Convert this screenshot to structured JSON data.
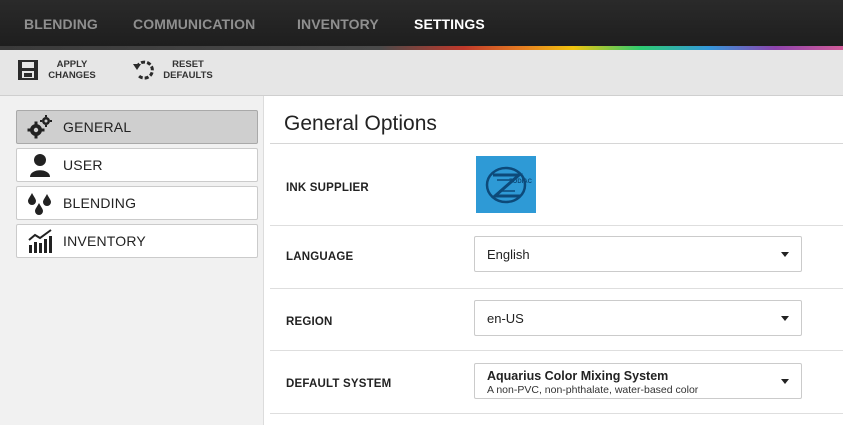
{
  "nav": {
    "tabs": [
      {
        "label": "BLENDING",
        "active": false
      },
      {
        "label": "COMMUNICATION",
        "active": false
      },
      {
        "label": "INVENTORY",
        "active": false
      },
      {
        "label": "SETTINGS",
        "active": true
      }
    ]
  },
  "toolbar": {
    "apply": {
      "line1": "APPLY",
      "line2": "CHANGES",
      "icon": "save-icon"
    },
    "reset": {
      "line1": "RESET",
      "line2": "DEFAULTS",
      "icon": "reset-icon"
    }
  },
  "sidebar": {
    "items": [
      {
        "label": "GENERAL",
        "icon": "gears-icon",
        "active": true
      },
      {
        "label": "USER",
        "icon": "user-icon",
        "active": false
      },
      {
        "label": "BLENDING",
        "icon": "drops-icon",
        "active": false
      },
      {
        "label": "INVENTORY",
        "icon": "chart-icon",
        "active": false
      }
    ]
  },
  "main": {
    "title": "General Options",
    "ink_supplier": {
      "label": "INK SUPPLIER",
      "logo_text": "ZODIAC",
      "logo_color": "#2e9ad6"
    },
    "language": {
      "label": "LANGUAGE",
      "value": "English"
    },
    "region": {
      "label": "REGION",
      "value": "en-US"
    },
    "default_system": {
      "label": "DEFAULT SYSTEM",
      "value_title": "Aquarius Color Mixing System",
      "value_subtitle": "A non-PVC, non-phthalate, water-based color"
    }
  }
}
